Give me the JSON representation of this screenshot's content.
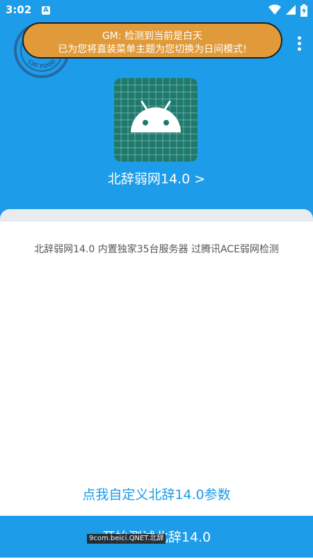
{
  "status_bar": {
    "time": "3:02",
    "notification_icon": "a-icon",
    "icons": [
      "wifi-icon",
      "signal-icon",
      "battery-charging-icon"
    ]
  },
  "toast": {
    "line1": "GM: 检测到当前是白天",
    "line2": "已为您将直装菜单主题为您切换为日间模式!"
  },
  "header": {
    "app_icon": "android-icon",
    "title": "北辞弱网14.0 >"
  },
  "main": {
    "description": "北辞弱网14.0 内置独家35台服务器 过腾讯ACE弱网检测",
    "custom_link": "点我自定义北辞14.0参数",
    "start_button": "开始测试北辞14.0"
  },
  "watermark": "9com.beici.QNET.北辞",
  "colors": {
    "primary": "#1c9ce9",
    "toast_bg": "#e19a3a",
    "app_icon_bg": "#1d7a6c"
  }
}
